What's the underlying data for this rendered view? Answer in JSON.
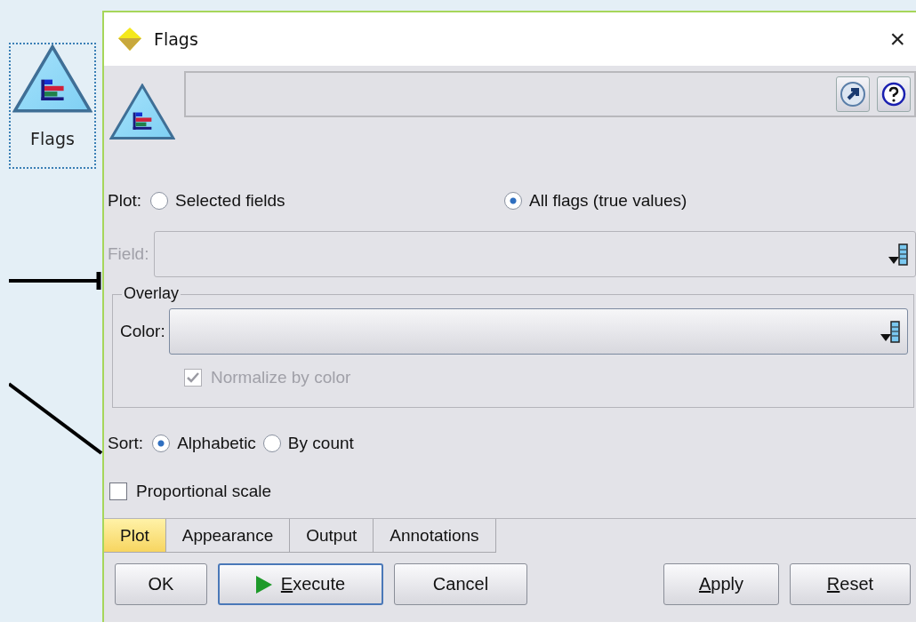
{
  "canvas": {
    "node": {
      "label": "Flags",
      "selected": true
    }
  },
  "window": {
    "title": "Flags",
    "close": "×"
  },
  "plot": {
    "label": "Plot:",
    "options": [
      {
        "label": "Selected fields",
        "selected": false
      },
      {
        "label": "All flags (true values)",
        "selected": true
      }
    ]
  },
  "field": {
    "label": "Field:",
    "disabled": true
  },
  "overlay": {
    "title": "Overlay",
    "color_label": "Color:",
    "normalize": {
      "label": "Normalize by color",
      "checked": true,
      "disabled": true
    }
  },
  "sort": {
    "label": "Sort:",
    "options": [
      {
        "label": "Alphabetic",
        "selected": true
      },
      {
        "label": "By count",
        "selected": false
      }
    ]
  },
  "proportional": {
    "label": "Proportional scale",
    "checked": false
  },
  "tabs": [
    {
      "label": "Plot",
      "selected": true
    },
    {
      "label": "Appearance",
      "selected": false
    },
    {
      "label": "Output",
      "selected": false
    },
    {
      "label": "Annotations",
      "selected": false
    }
  ],
  "buttons": [
    {
      "label": "OK",
      "kind": "plain",
      "underline_first": false,
      "focused": false
    },
    {
      "label": "Execute",
      "kind": "run",
      "underline_first": true,
      "focused": true
    },
    {
      "label": "Cancel",
      "kind": "plain",
      "underline_first": false,
      "focused": false
    },
    {
      "label": "Apply",
      "kind": "plain",
      "underline_first": true,
      "focused": false
    },
    {
      "label": "Reset",
      "kind": "plain",
      "underline_first": true,
      "focused": false
    }
  ]
}
